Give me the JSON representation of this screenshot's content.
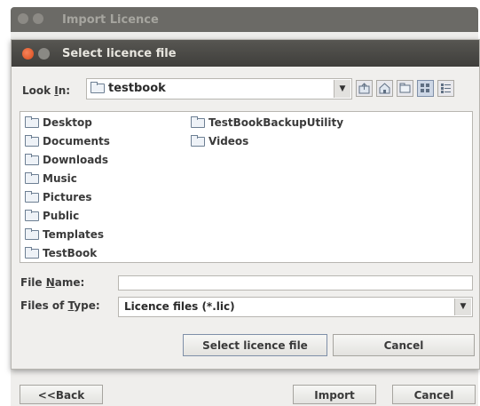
{
  "background_window": {
    "title": "Import Licence"
  },
  "dialog": {
    "title": "Select licence file",
    "look_in_label_pre": "Look ",
    "look_in_label_u": "I",
    "look_in_label_post": "n:",
    "look_in_value": "testbook",
    "files_left": [
      "Desktop",
      "Documents",
      "Downloads",
      "Music",
      "Pictures",
      "Public",
      "Templates",
      "TestBook"
    ],
    "files_right": [
      "TestBookBackupUtility",
      "Videos"
    ],
    "file_name_label_pre": "File ",
    "file_name_label_u": "N",
    "file_name_label_post": "ame:",
    "file_name_value": "",
    "files_of_type_label_pre": "Files of ",
    "files_of_type_label_u": "T",
    "files_of_type_label_post": "ype:",
    "files_of_type_value": "Licence files (*.lic)",
    "select_button": "Select licence file",
    "cancel_button": "Cancel"
  },
  "wizard": {
    "back_button": "<<Back",
    "import_button": "Import",
    "cancel_button": "Cancel"
  },
  "colors": {
    "titlebar": "#454441",
    "close_button": "#e8592c",
    "selection_accent": "#7f8fa8"
  }
}
